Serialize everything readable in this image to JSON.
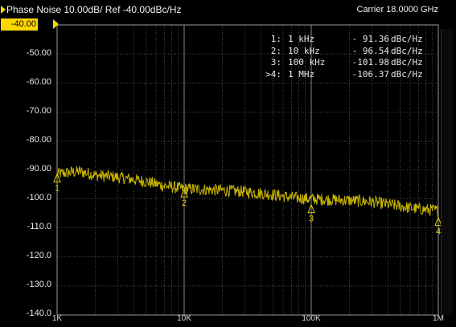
{
  "header": {
    "trace_title": "Phase Noise 10.00dB/ Ref -40.00dBc/Hz",
    "carrier": "Carrier 18.0000 GHz"
  },
  "colors": {
    "background": "#000000",
    "trace": "#c8b400",
    "grid": "#7a7a7a",
    "text": "#e8e8e8",
    "active_trace": "#ffd700"
  },
  "markers": [
    {
      "id": "1:",
      "freq": "1 kHz",
      "value": "- 91.36",
      "unit": "dBc/Hz"
    },
    {
      "id": "2:",
      "freq": "10 kHz",
      "value": "- 96.54",
      "unit": "dBc/Hz"
    },
    {
      "id": "3:",
      "freq": "100 kHz",
      "value": "-101.98",
      "unit": "dBc/Hz"
    },
    {
      "id": ">4:",
      "freq": "1 MHz",
      "value": "-106.37",
      "unit": "dBc/Hz"
    }
  ],
  "chart_data": {
    "type": "line",
    "title": "Phase Noise 10.00dB/ Ref -40.00dBc/Hz",
    "xscale": "log",
    "xlim": [
      1000,
      10000000
    ],
    "ylim": [
      -140,
      -40
    ],
    "yticks": [
      "-40.00",
      "-50.00",
      "-60.00",
      "-70.00",
      "-80.00",
      "-90.00",
      "-100.0",
      "-110.0",
      "-120.0",
      "-130.0",
      "-140.0"
    ],
    "xticks": [
      "1K",
      "10K",
      "100K",
      "1M"
    ],
    "grid": true,
    "series": [
      {
        "x": [
          1000,
          1500,
          2000,
          3000,
          5000,
          7000,
          10000,
          20000,
          30000,
          50000,
          70000,
          100000,
          200000,
          300000,
          500000,
          700000,
          1000000
        ],
        "values": [
          -91.4,
          -90.5,
          -91.8,
          -92.5,
          -94.0,
          -95.5,
          -96.5,
          -97.0,
          -97.5,
          -98.5,
          -99.5,
          -100.0,
          -100.5,
          -101.0,
          -102.5,
          -103.5,
          -104.0
        ]
      }
    ],
    "markers": [
      {
        "label": "1",
        "x": 1000,
        "y": -91.36
      },
      {
        "label": "2",
        "x": 10000,
        "y": -96.54
      },
      {
        "label": "3",
        "x": 100000,
        "y": -101.98
      },
      {
        "label": "4",
        "x": 1000000,
        "y": -106.37
      }
    ]
  }
}
